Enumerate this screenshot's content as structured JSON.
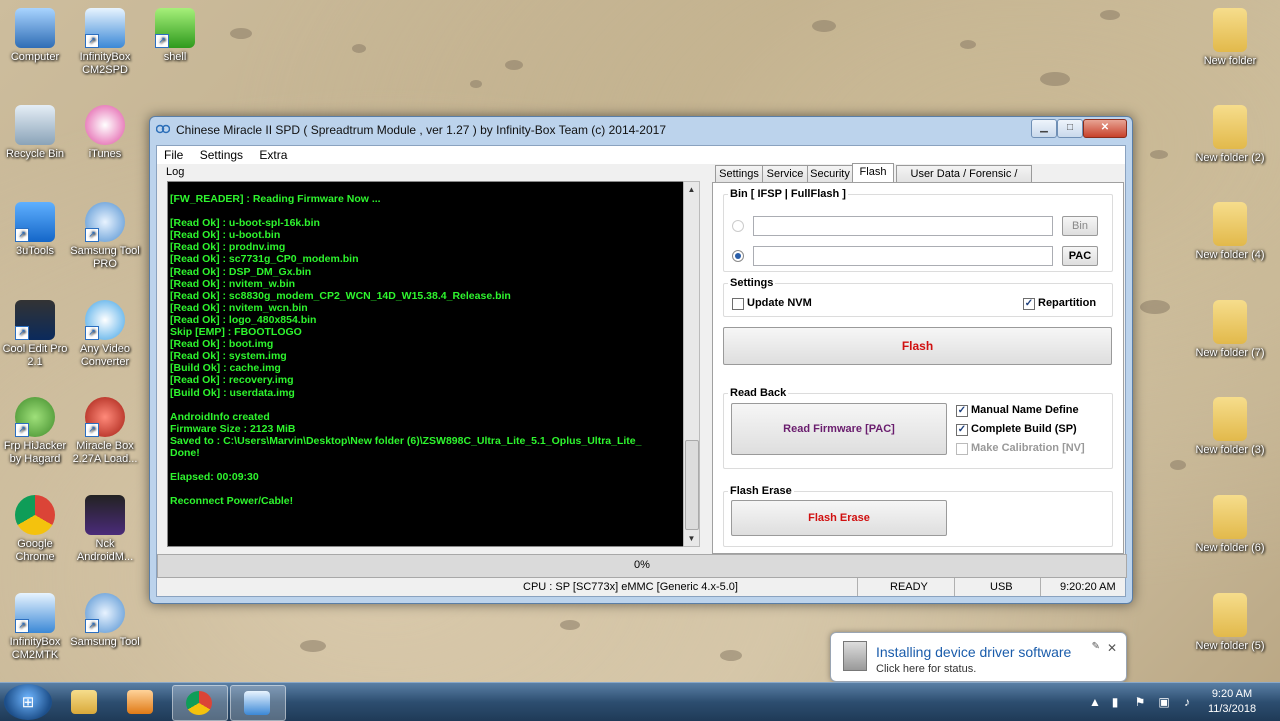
{
  "desktop": {
    "left_icons": [
      {
        "label": "Computer",
        "icon": "computer-icon"
      },
      {
        "label": "InfinityBox CM2SPD",
        "icon": "spd-icon"
      },
      {
        "label": "shell",
        "icon": "shell-icon"
      },
      {
        "label": "Recycle Bin",
        "icon": "recycle-bin-icon"
      },
      {
        "label": "iTunes",
        "icon": "itunes-icon"
      },
      {
        "label": "3uTools",
        "icon": "3utools-icon"
      },
      {
        "label": "Samsung Tool PRO",
        "icon": "samsung-tool-pro-icon"
      },
      {
        "label": "Cool Edit Pro 2.1",
        "icon": "cool-edit-icon"
      },
      {
        "label": "Any Video Converter",
        "icon": "video-converter-icon"
      },
      {
        "label": "Frp HiJacker by Hagard",
        "icon": "frp-icon"
      },
      {
        "label": "Miracle Box 2.27A Load...",
        "icon": "miracle-box-icon"
      },
      {
        "label": "Google Chrome",
        "icon": "chrome-icon"
      },
      {
        "label": "Nck AndroidM...",
        "icon": "nck-icon"
      },
      {
        "label": "InfinityBox CM2MTK",
        "icon": "mtk-icon"
      },
      {
        "label": "Samsung Tool",
        "icon": "samsung-tool-icon"
      }
    ],
    "right_folders": [
      {
        "label": "New folder"
      },
      {
        "label": "New folder (2)"
      },
      {
        "label": "New folder (4)"
      },
      {
        "label": "New folder (7)"
      },
      {
        "label": "New folder (3)"
      },
      {
        "label": "New folder (6)"
      },
      {
        "label": "New folder (5)"
      }
    ]
  },
  "window": {
    "title": "Chinese Miracle II SPD ( Spreadtrum Module , ver 1.27 ) by Infinity-Box Team (c) 2014-2017",
    "menu": [
      "File",
      "Settings",
      "Extra"
    ],
    "log_label": "Log",
    "log_lines": [
      "[FW_READER] : Reading Firmware Now ...",
      "",
      "[Read Ok] : u-boot-spl-16k.bin",
      "[Read Ok] : u-boot.bin",
      "[Read Ok] : prodnv.img",
      "[Read Ok] : sc7731g_CP0_modem.bin",
      "[Read Ok] : DSP_DM_Gx.bin",
      "[Read Ok] : nvitem_w.bin",
      "[Read Ok] : sc8830g_modem_CP2_WCN_14D_W15.38.4_Release.bin",
      "[Read Ok] : nvitem_wcn.bin",
      "[Read Ok] : logo_480x854.bin",
      "Skip [EMP] : FBOOTLOGO",
      "[Read Ok] : boot.img",
      "[Read Ok] : system.img",
      "[Build Ok] : cache.img",
      "[Read Ok] : recovery.img",
      "[Build Ok] : userdata.img",
      "",
      "AndroidInfo created",
      "Firmware Size : 2123 MiB",
      "Saved to : C:\\Users\\Marvin\\Desktop\\New folder (6)\\ZSW898C_Ultra_Lite_5.1_Oplus_Ultra_Lite_",
      "Done!",
      "",
      "Elapsed: 00:09:30",
      "",
      "Reconnect Power/Cable!"
    ],
    "tabs": [
      "Settings",
      "Service",
      "Security",
      "Flash",
      "User Data / Forensic / Other"
    ],
    "active_tab": "Flash",
    "bin_group": {
      "label": "Bin  [ IFSP | FullFlash ]",
      "bin_button": "Bin",
      "pac_button": "PAC"
    },
    "settings_group": {
      "label": "Settings",
      "update_nvm": "Update NVM",
      "repartition": "Repartition"
    },
    "flash_button": "Flash",
    "read_back": {
      "label": "Read Back",
      "read_firmware_button": "Read Firmware [PAC]",
      "manual_name": "Manual Name Define",
      "complete_build": "Complete Build (SP)",
      "make_calibration": "Make Calibration [NV]"
    },
    "flash_erase": {
      "label": "Flash Erase",
      "button": "Flash Erase"
    },
    "progress_text": "0%",
    "progress_value": 0,
    "status": {
      "cpu": "CPU : SP [SC773x] eMMC [Generic 4.x-5.0]",
      "state": "READY",
      "port": "USB",
      "time": "9:20:20 AM"
    }
  },
  "notification": {
    "title": "Installing device driver software",
    "subtitle": "Click here for status."
  },
  "taskbar": {
    "clock_time": "9:20 AM",
    "clock_date": "11/3/2018",
    "items": [
      "explorer-icon",
      "media-player-icon",
      "chrome-icon",
      "spd-icon"
    ]
  },
  "colors": {
    "log_text": "#2ef52e",
    "flash_text": "#d01010",
    "read_firmware_text": "#6a1d6e"
  }
}
